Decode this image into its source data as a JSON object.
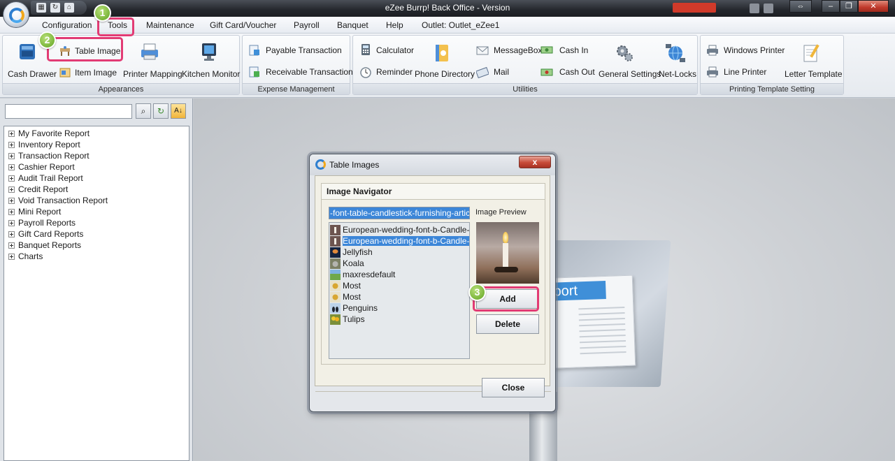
{
  "title_bar": {
    "title": "eZee Burrp! Back Office - Version"
  },
  "menu": {
    "items": [
      "Configuration",
      "Tools",
      "Maintenance",
      "Gift Card/Voucher",
      "Payroll",
      "Banquet",
      "Help",
      "Outlet: Outlet_eZee1"
    ]
  },
  "ribbon": {
    "appearances": {
      "label": "Appearances",
      "cash_drawer": "Cash Drawer",
      "table_image": "Table Image",
      "item_image": "Item Image",
      "printer_mapping": "Printer Mapping",
      "kitchen_monitor": "Kitchen Monitor"
    },
    "expense": {
      "label": "Expense Management",
      "payable": "Payable Transaction",
      "receivable": "Receivable Transaction"
    },
    "utilities": {
      "label": "Utilities",
      "calculator": "Calculator",
      "reminder": "Reminder",
      "phone_directory": "Phone Directory",
      "messagebox": "MessageBox",
      "mail": "Mail",
      "cash_in": "Cash In",
      "cash_out": "Cash Out",
      "general_settings": "General Settings",
      "net_locks": "Net-Locks"
    },
    "printing": {
      "label": "Printing Template Setting",
      "windows_printer": "Windows Printer",
      "line_printer": "Line Printer",
      "letter_template": "Letter Template"
    }
  },
  "sidebar": {
    "search_value": "",
    "tree_items": [
      "My Favorite Report",
      "Inventory Report",
      "Transaction Report",
      "Cashier Report",
      "Audit Trail Report",
      "Credit Report",
      "Void Transaction Report",
      "Mini Report",
      "Payroll Reports",
      "Gift Card Reports",
      "Banquet Reports",
      "Charts"
    ]
  },
  "background": {
    "report_text": "eport"
  },
  "dialog": {
    "title": "Table Images",
    "close_x": "x",
    "section_title": "Image Navigator",
    "selected_name": "-font-table-candlestick-furnishing-articles",
    "preview_label": "Image Preview",
    "images": [
      {
        "name": "European-wedding-font-b-Candle-b",
        "selected": false,
        "icon": "candle-thumb"
      },
      {
        "name": "European-wedding-font-b-Candle-b",
        "selected": true,
        "icon": "candle-thumb"
      },
      {
        "name": "Jellyfish",
        "selected": false,
        "icon": "jellyfish-thumb"
      },
      {
        "name": "Koala",
        "selected": false,
        "icon": "koala-thumb"
      },
      {
        "name": "maxresdefault",
        "selected": false,
        "icon": "landscape-thumb"
      },
      {
        "name": "Most",
        "selected": false,
        "icon": "sun-thumb"
      },
      {
        "name": "Most",
        "selected": false,
        "icon": "sun-thumb"
      },
      {
        "name": "Penguins",
        "selected": false,
        "icon": "penguins-thumb"
      },
      {
        "name": "Tulips",
        "selected": false,
        "icon": "tulips-thumb"
      }
    ],
    "add_label": "Add",
    "delete_label": "Delete",
    "close_label": "Close"
  },
  "callouts": [
    "1",
    "2",
    "3"
  ],
  "colors": {
    "highlight": "#e23b74",
    "badge": "#7ab53a",
    "selection": "#3c86d8",
    "title_bar": "#24272c"
  }
}
